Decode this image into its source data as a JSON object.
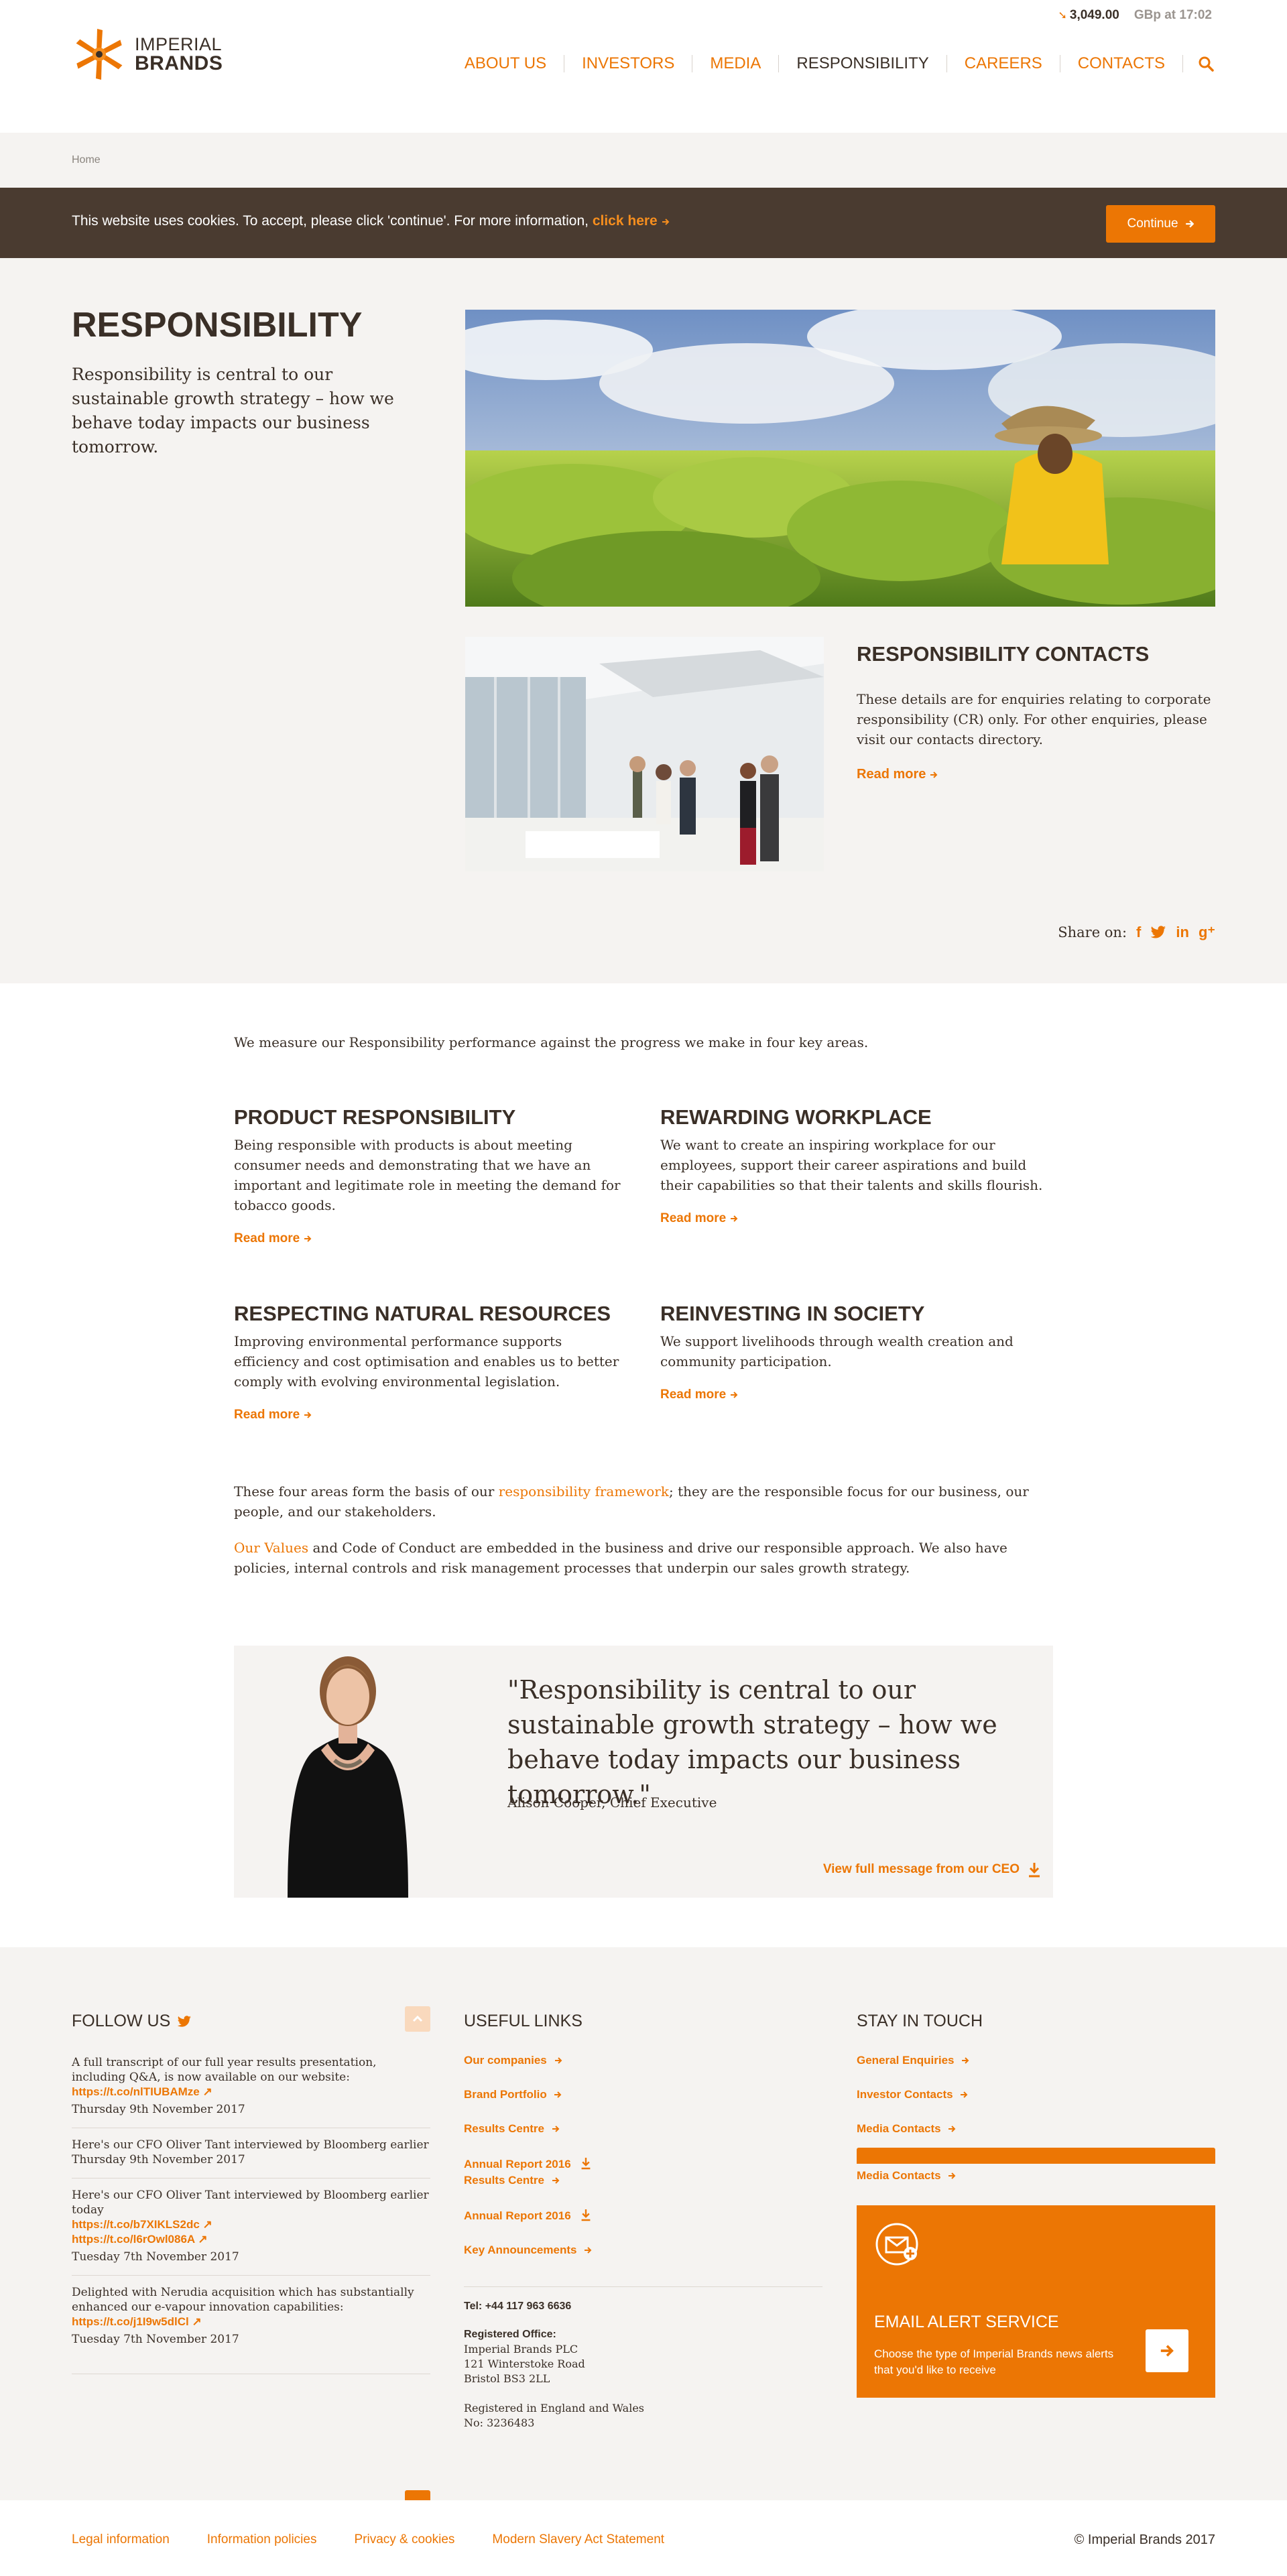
{
  "ticker": {
    "value": "3,049.00",
    "time": "GBp at 17:02"
  },
  "logo": {
    "line1": "IMPERIAL",
    "line2": "BRANDS"
  },
  "nav": [
    "ABOUT US",
    "INVESTORS",
    "MEDIA",
    "RESPONSIBILITY",
    "CAREERS",
    "CONTACTS"
  ],
  "breadcrumb": "Home",
  "cookie": {
    "message": "This website uses cookies. To accept, please click 'continue'. For more information,",
    "link": "click here",
    "button": "Continue"
  },
  "hero": {
    "title": "RESPONSIBILITY",
    "intro": "Responsibility is central to our sustainable growth strategy – how we behave today impacts our business tomorrow."
  },
  "contacts": {
    "title": "RESPONSIBILITY CONTACTS",
    "text": "These details are for enquiries relating to corporate responsibility (CR) only. For other enquiries, please visit our contacts directory.",
    "link": "Read more"
  },
  "share": {
    "label": "Share on:"
  },
  "content": {
    "lead": "We measure our Responsibility performance against the progress we make in four key areas.",
    "areas": [
      {
        "title": "PRODUCT RESPONSIBILITY",
        "text": "Being responsible with products is about meeting consumer needs and demonstrating that we have an important and legitimate role in meeting the demand for tobacco goods.",
        "link": "Read more"
      },
      {
        "title": "REWARDING WORKPLACE",
        "text": "We want to create an inspiring workplace for our employees, support their career aspirations and build their capabilities so that their talents and skills flourish.",
        "link": "Read more"
      },
      {
        "title": "RESPECTING NATURAL RESOURCES",
        "text": "Improving environmental performance supports efficiency and cost optimisation and enables us to better comply with evolving environmental legislation.",
        "link": "Read more"
      },
      {
        "title": "REINVESTING IN SOCIETY",
        "text": "We support livelihoods through wealth creation and community participation.",
        "link": "Read more"
      }
    ],
    "para1_before": "These four areas form the basis of our ",
    "para1_link": "responsibility framework",
    "para1_after": "; they are the responsible focus for our business, our people, and our stakeholders.",
    "para2_link": "Our Values",
    "para2_after": " and Code of Conduct are embedded in the business and drive our responsible approach. We also have policies, internal controls and risk management processes that underpin our sales growth strategy."
  },
  "quote": {
    "text": "\"Responsibility is central to our sustainable growth strategy – how we behave today impacts our business tomorrow.\"",
    "author": "Alison Cooper, Chief Executive",
    "link": "View full message from our CEO"
  },
  "footer": {
    "follow_title": "FOLLOW US",
    "tweets": [
      {
        "text": "A full transcript of our full year results presentation, including Q&A, is now available on our website:",
        "links": [
          "https://t.co/nlTIUBAMze"
        ],
        "date": "Thursday 9th November 2017"
      },
      {
        "text": "Here's our CFO Oliver Tant interviewed by Bloomberg earlier",
        "links": [],
        "date": "Thursday 9th November 2017"
      },
      {
        "text": "Here's our CFO Oliver Tant interviewed by Bloomberg earlier today",
        "links": [
          "https://t.co/b7XIKLS2dc",
          "https://t.co/l6rOwl086A"
        ],
        "date": "Tuesday 7th November 2017"
      },
      {
        "text": "Delighted with Nerudia acquisition which has substantially enhanced our e-vapour innovation capabilities:",
        "links": [
          "https://t.co/j1I9w5dlCl"
        ],
        "date": "Tuesday 7th November 2017"
      }
    ],
    "useful_title": "USEFUL LINKS",
    "useful_links": [
      "Our companies",
      "Brand Portfolio",
      "Results Centre",
      "Annual Report 2016",
      "Results Centre",
      "Annual Report 2016",
      "Key Announcements"
    ],
    "tel": "Tel: +44 117 963 6636",
    "office_title": "Registered Office:",
    "office_lines": [
      "Imperial Brands PLC",
      "121 Winterstoke Road",
      "Bristol BS3 2LL"
    ],
    "registered_lines": [
      "Registered in England and Wales",
      "No: 3236483"
    ],
    "stay_title": "STAY IN TOUCH",
    "stay_links": [
      "General Enquiries",
      "Investor Contacts",
      "Media Contacts",
      "Media Contacts"
    ],
    "email_title": "EMAIL ALERT SERVICE",
    "email_text": "Choose the type of Imperial Brands news alerts that you'd like to receive"
  },
  "bottom": {
    "links": [
      "Legal information",
      "Information policies",
      "Privacy & cookies",
      "Modern Slavery Act Statement"
    ],
    "copyright": "© Imperial Brands 2017"
  },
  "colors": {
    "accent": "#ec7604",
    "dark": "#3a2f27",
    "cookie_bg": "#4a3b30",
    "panel_bg": "#f5f3f1"
  }
}
